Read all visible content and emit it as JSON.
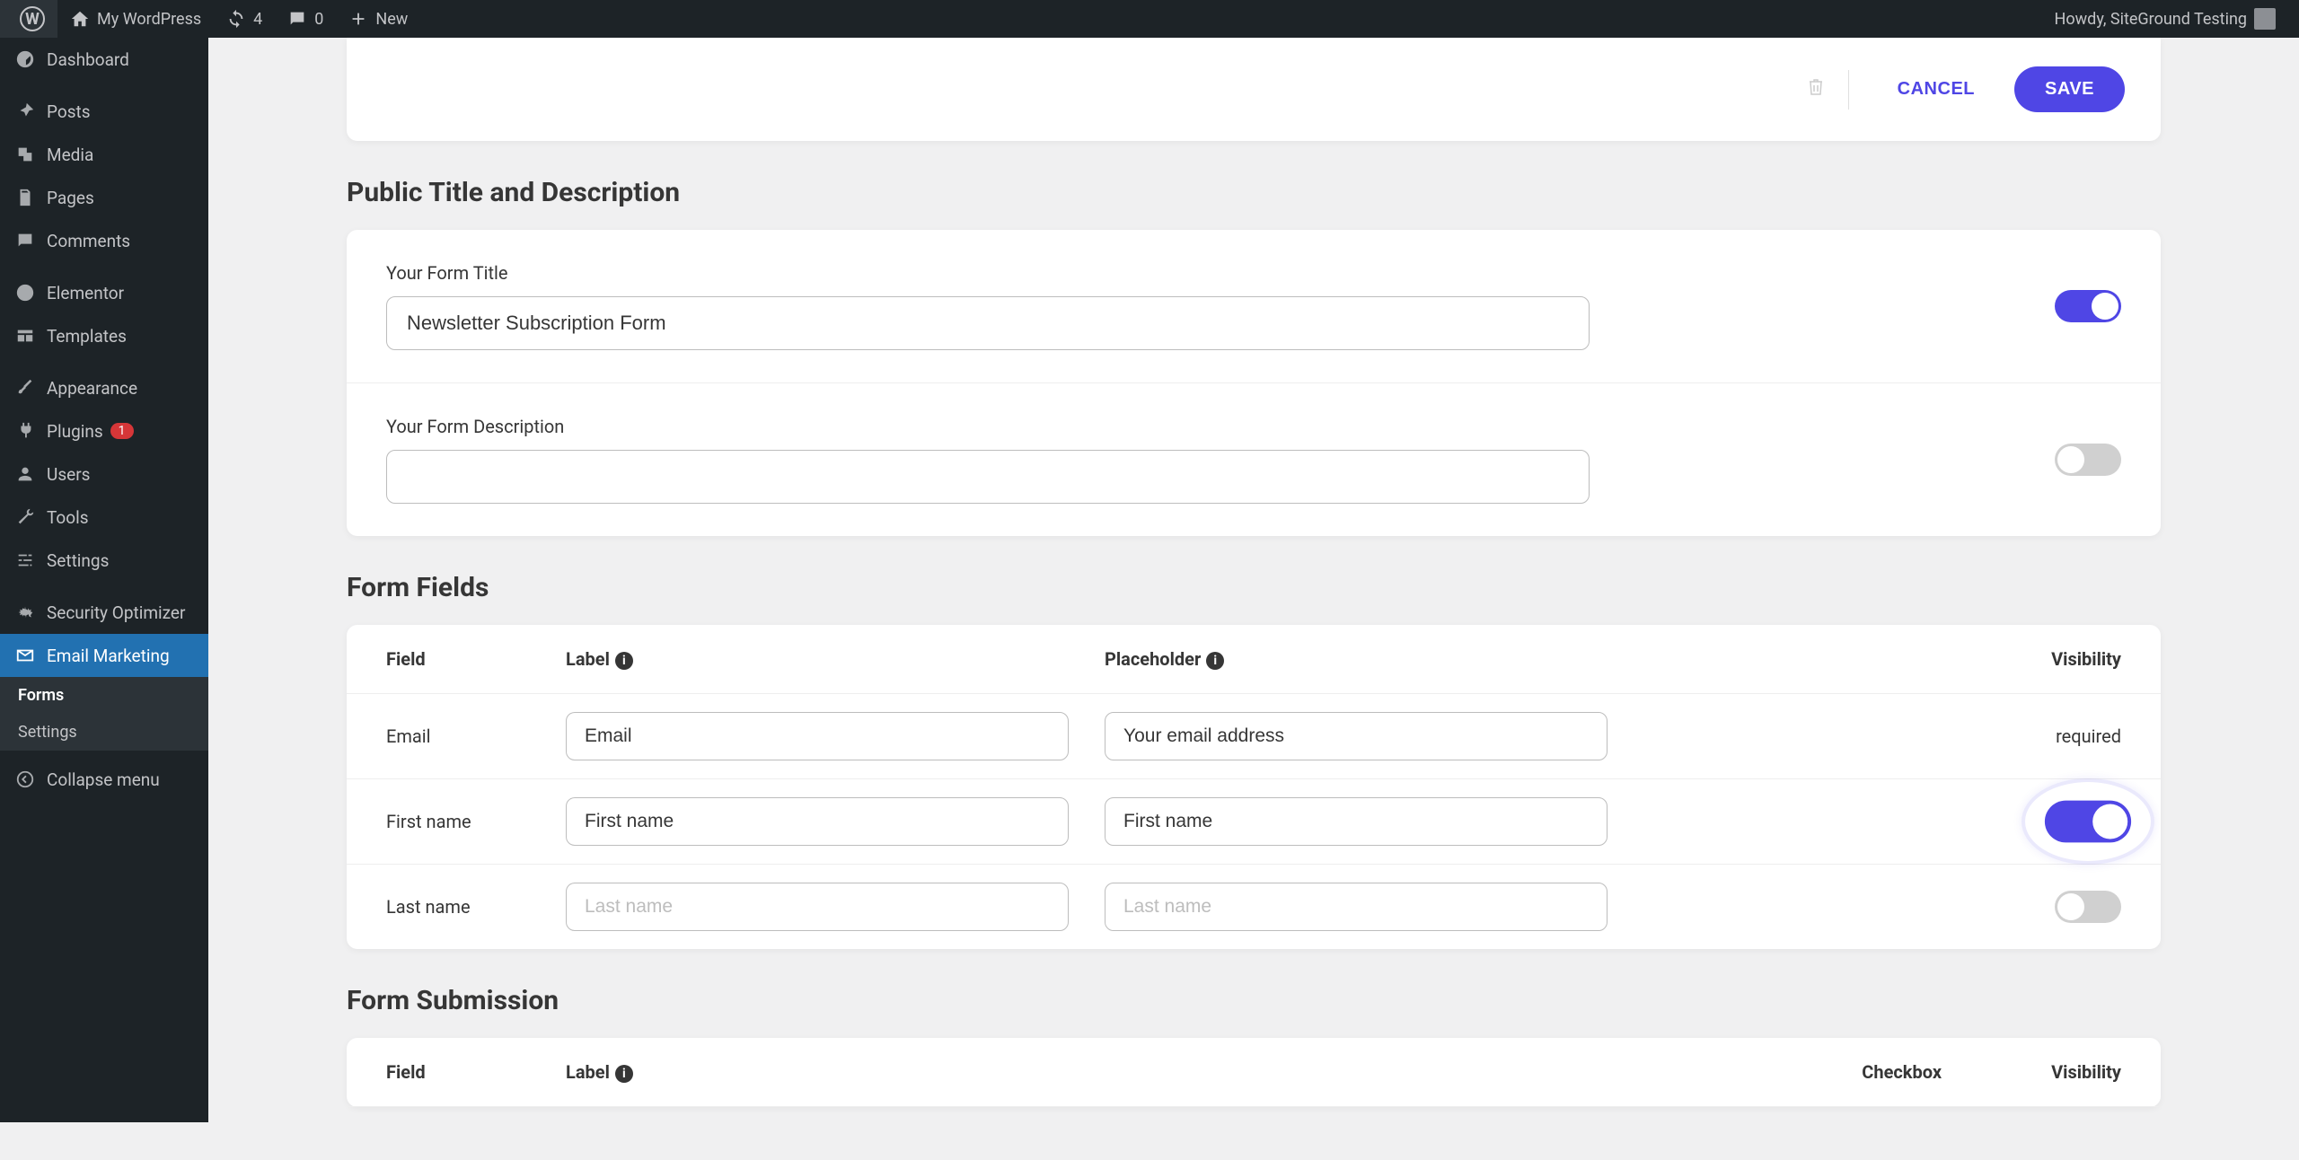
{
  "admin_bar": {
    "site_name": "My WordPress",
    "updates": "4",
    "comments": "0",
    "new": "New",
    "howdy": "Howdy, SiteGround Testing"
  },
  "sidebar": {
    "items": [
      {
        "label": "Dashboard"
      },
      {
        "label": "Posts"
      },
      {
        "label": "Media"
      },
      {
        "label": "Pages"
      },
      {
        "label": "Comments"
      },
      {
        "label": "Elementor"
      },
      {
        "label": "Templates"
      },
      {
        "label": "Appearance"
      },
      {
        "label": "Plugins",
        "badge": "1"
      },
      {
        "label": "Users"
      },
      {
        "label": "Tools"
      },
      {
        "label": "Settings"
      },
      {
        "label": "Security Optimizer"
      },
      {
        "label": "Email Marketing"
      }
    ],
    "submenu": [
      {
        "label": "Forms"
      },
      {
        "label": "Settings"
      }
    ],
    "collapse": "Collapse menu"
  },
  "actions": {
    "cancel": "CANCEL",
    "save": "SAVE"
  },
  "sections": {
    "title_desc": "Public Title and Description",
    "form_title_label": "Your Form Title",
    "form_title_value": "Newsletter Subscription Form",
    "form_desc_label": "Your Form Description",
    "form_desc_value": ""
  },
  "form_fields": {
    "heading": "Form Fields",
    "columns": {
      "field": "Field",
      "label": "Label",
      "placeholder": "Placeholder",
      "visibility": "Visibility"
    },
    "rows": [
      {
        "field": "Email",
        "label": "Email",
        "placeholder": "Your email address",
        "visibility": "required"
      },
      {
        "field": "First name",
        "label": "First name",
        "placeholder": "First name",
        "visibility_toggle": true
      },
      {
        "field": "Last name",
        "label": "Last name",
        "placeholder": "Last name",
        "visibility_toggle": false
      }
    ]
  },
  "submission": {
    "heading": "Form Submission",
    "columns": {
      "field": "Field",
      "label": "Label",
      "checkbox": "Checkbox",
      "visibility": "Visibility"
    }
  }
}
